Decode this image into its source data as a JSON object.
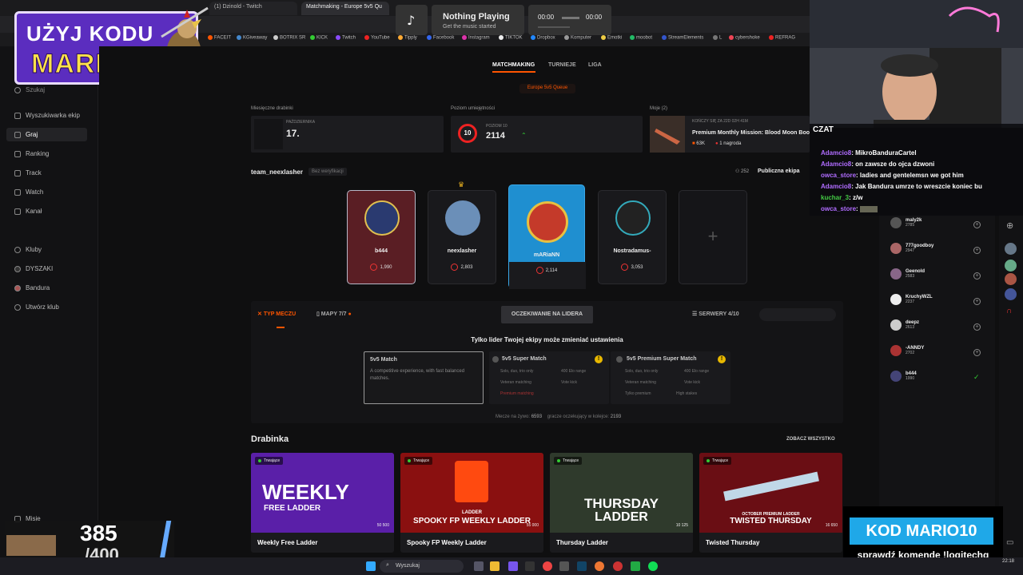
{
  "browser": {
    "tabs": [
      "(1) Dzinold - Twitch",
      "Matchmaking - Europe 5v5 Qu"
    ],
    "bookmarks": [
      "FACEIT",
      "KGiveaway",
      "BOTRIX SR",
      "KICK",
      "Twitch",
      "YouTube",
      "Tipply",
      "Facebook",
      "Instagram",
      "TIKTOK",
      "Dropbox",
      "Komputer",
      "Emotki",
      "moobot",
      "StreamElements",
      "L",
      "cybershoke",
      "REFRAG"
    ]
  },
  "media": {
    "title": "Nothing Playing",
    "subtitle": "Get the music started",
    "time_start": "00:00",
    "time_end": "00:00"
  },
  "promo": {
    "line1": "UŻYJ KODU",
    "line2": "MARIOZOO"
  },
  "sidebar": {
    "search_placeholder": "Szukaj",
    "items": [
      {
        "label": "Wyszukiwarka ekip",
        "icon": "search-icon"
      },
      {
        "label": "Graj",
        "icon": "play-icon"
      },
      {
        "label": "Ranking",
        "icon": "chart-icon"
      },
      {
        "label": "Track",
        "icon": "track-icon"
      },
      {
        "label": "Watch",
        "icon": "watch-icon"
      },
      {
        "label": "Kanał",
        "icon": "channel-icon"
      }
    ],
    "clubs": [
      {
        "label": "Kluby",
        "icon": "clubs-icon"
      },
      {
        "label": "DYSZAKI",
        "icon": "club-icon"
      },
      {
        "label": "Bandura",
        "icon": "club-icon"
      },
      {
        "label": "Utwórz klub",
        "icon": "plus-icon"
      }
    ],
    "missions": "Misje"
  },
  "nav": {
    "tabs": [
      "MATCHMAKING",
      "TURNIEJE",
      "LIGA"
    ],
    "queue": "Europe 5v5 Queue"
  },
  "stats": {
    "monthly_label": "Miesięczne drabinki",
    "monthly_sub": "PAŹDZIERNIKA",
    "monthly_value": "17.",
    "skill_label": "Poziom umiejętności",
    "skill_sub": "POZIOM 10",
    "skill_level": "10",
    "skill_value": "2114",
    "mine_label": "Moje (2)",
    "mission_timer": "KOŃCZY SIĘ ZA 22D 02H 41M",
    "mission_title": "Premium Monthly Mission: Blood Moon Boo",
    "mission_reward": "63K",
    "mission_prize": "1 nagroda"
  },
  "team": {
    "name": "team_neexlasher",
    "verify": "Bez weryfikacji",
    "count": "252",
    "privacy": "Publiczna ekipa",
    "members": [
      {
        "name": "b444",
        "elo": "1,990"
      },
      {
        "name": "neexlasher",
        "elo": "2,803"
      },
      {
        "name": "mARiaNN",
        "elo": "2,114"
      },
      {
        "name": "Nostradamus-",
        "elo": "3,053"
      }
    ]
  },
  "match": {
    "type_tab": "TYP MECZU",
    "maps_tab": "MAPY 7/7",
    "waiting": "OCZEKIWANIE NA LIDERA",
    "servers": "SERWERY 4/10",
    "leader_note": "Tylko lider Twojej ekipy może zmieniać ustawienia",
    "modes": [
      {
        "title": "5v5 Match",
        "desc": "A competitive experience, with fast balanced matches."
      },
      {
        "title": "5v5 Super Match",
        "f1": "Solo, duo, trio only",
        "f2": "400 Elo range",
        "f3": "Veteran matching",
        "f4": "Vote kick",
        "f5": "Premium matching"
      },
      {
        "title": "5v5 Premium Super Match",
        "f1": "Solo, duo, trio only",
        "f2": "400 Elo range",
        "f3": "Veteran matching",
        "f4": "Vote kick",
        "f5": "Tylko premium",
        "f6": "High stakes"
      }
    ],
    "live_label": "Mecze na żywo:",
    "live_value": "6593",
    "queue_label": "gracze oczekujący w kolejce:",
    "queue_value": "2193"
  },
  "ladders": {
    "title": "Drabinka",
    "see_all": "ZOBACZ WSZYSTKO",
    "items": [
      {
        "status": "Trwające",
        "big1": "WEEKLY",
        "big2": "FREE LADDER",
        "prize": "50 500",
        "name": "Weekly Free Ladder",
        "color": "#5a1fa8"
      },
      {
        "status": "Trwające",
        "big1": "LADDER",
        "big2": "SPOOKY FP WEEKLY LADDER",
        "prize": "55 000",
        "name": "Spooky FP Weekly Ladder",
        "color": "#8a1010"
      },
      {
        "status": "Trwające",
        "big1": "THURSDAY",
        "big2": "LADDER",
        "prize": "10 125",
        "name": "Thursday Ladder",
        "color": "#2f3a2c"
      },
      {
        "status": "Trwające",
        "big1": "OCTOBER PREMIUM LADDER",
        "big2": "TWISTED THURSDAY",
        "prize": "16 650",
        "name": "Twisted Thursday",
        "color": "#6a0e14"
      }
    ]
  },
  "friends": [
    {
      "name": "maly2k",
      "elo": "2785"
    },
    {
      "name": "777goodboy",
      "elo": "2947"
    },
    {
      "name": "Geenold",
      "elo": "2583"
    },
    {
      "name": "KruchyWZL",
      "elo": "2237"
    },
    {
      "name": "deepz",
      "elo": "2613"
    },
    {
      "name": "-ANNDY",
      "elo": "2702"
    },
    {
      "name": "b444",
      "elo": "1990"
    }
  ],
  "chat": {
    "title": "CZAT",
    "lines": [
      {
        "user": "Adamcio8",
        "msg": "MikroBanduraCartel"
      },
      {
        "user": "Adamcio8",
        "msg": "on zawsze do ojca dzwoni"
      },
      {
        "user": "owca_store",
        "msg": "ladies and gentelemsn we got him"
      },
      {
        "user": "Adamcio8",
        "msg": "Jak Bandura umrze to wreszcie koniec bu"
      },
      {
        "user": "kuchar_3",
        "msg": "z/w"
      },
      {
        "user": "owca_store",
        "msg": ""
      }
    ]
  },
  "counter": {
    "value": "385",
    "total": "/400"
  },
  "kod": {
    "code": "KOD MARIO10",
    "sub": "sprawdź komendę !logitechg"
  },
  "taskbar": {
    "search": "Wyszukaj",
    "time": "22:18"
  },
  "colors": {
    "accent": "#ff5500",
    "bg": "#0f0f10"
  }
}
